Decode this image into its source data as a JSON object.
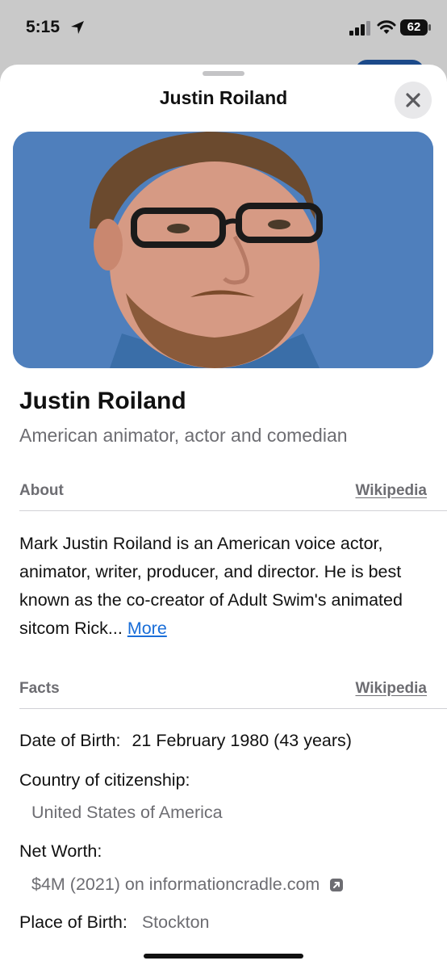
{
  "status_bar": {
    "time": "5:15",
    "battery": "62",
    "icons": [
      "location-arrow-icon",
      "signal-icon",
      "wifi-icon",
      "battery-icon"
    ]
  },
  "sheet": {
    "title": "Justin Roiland"
  },
  "entity": {
    "name": "Justin Roiland",
    "description": "American animator, actor and comedian"
  },
  "about": {
    "label": "About",
    "source": "Wikipedia",
    "text": "Mark Justin Roiland is an American voice actor, animator, writer, producer, and director. He is best known as the co-creator of Adult Swim's animated sitcom Rick...",
    "more_label": "More"
  },
  "facts": {
    "label": "Facts",
    "source": "Wikipedia",
    "items": [
      {
        "label": "Date of Birth:",
        "value": "21 February 1980 (43 years)"
      },
      {
        "label": "Country of citizenship:",
        "value": "United States of America"
      },
      {
        "label": "Net Worth:",
        "value": "$4M (2021) on informationcradle.com"
      },
      {
        "label": "Place of Birth:",
        "value": "Stockton"
      }
    ]
  },
  "colors": {
    "accent_link": "#1a6ed8",
    "secondary_text": "#6d6d72",
    "photo_background": "#4f7fbc"
  }
}
